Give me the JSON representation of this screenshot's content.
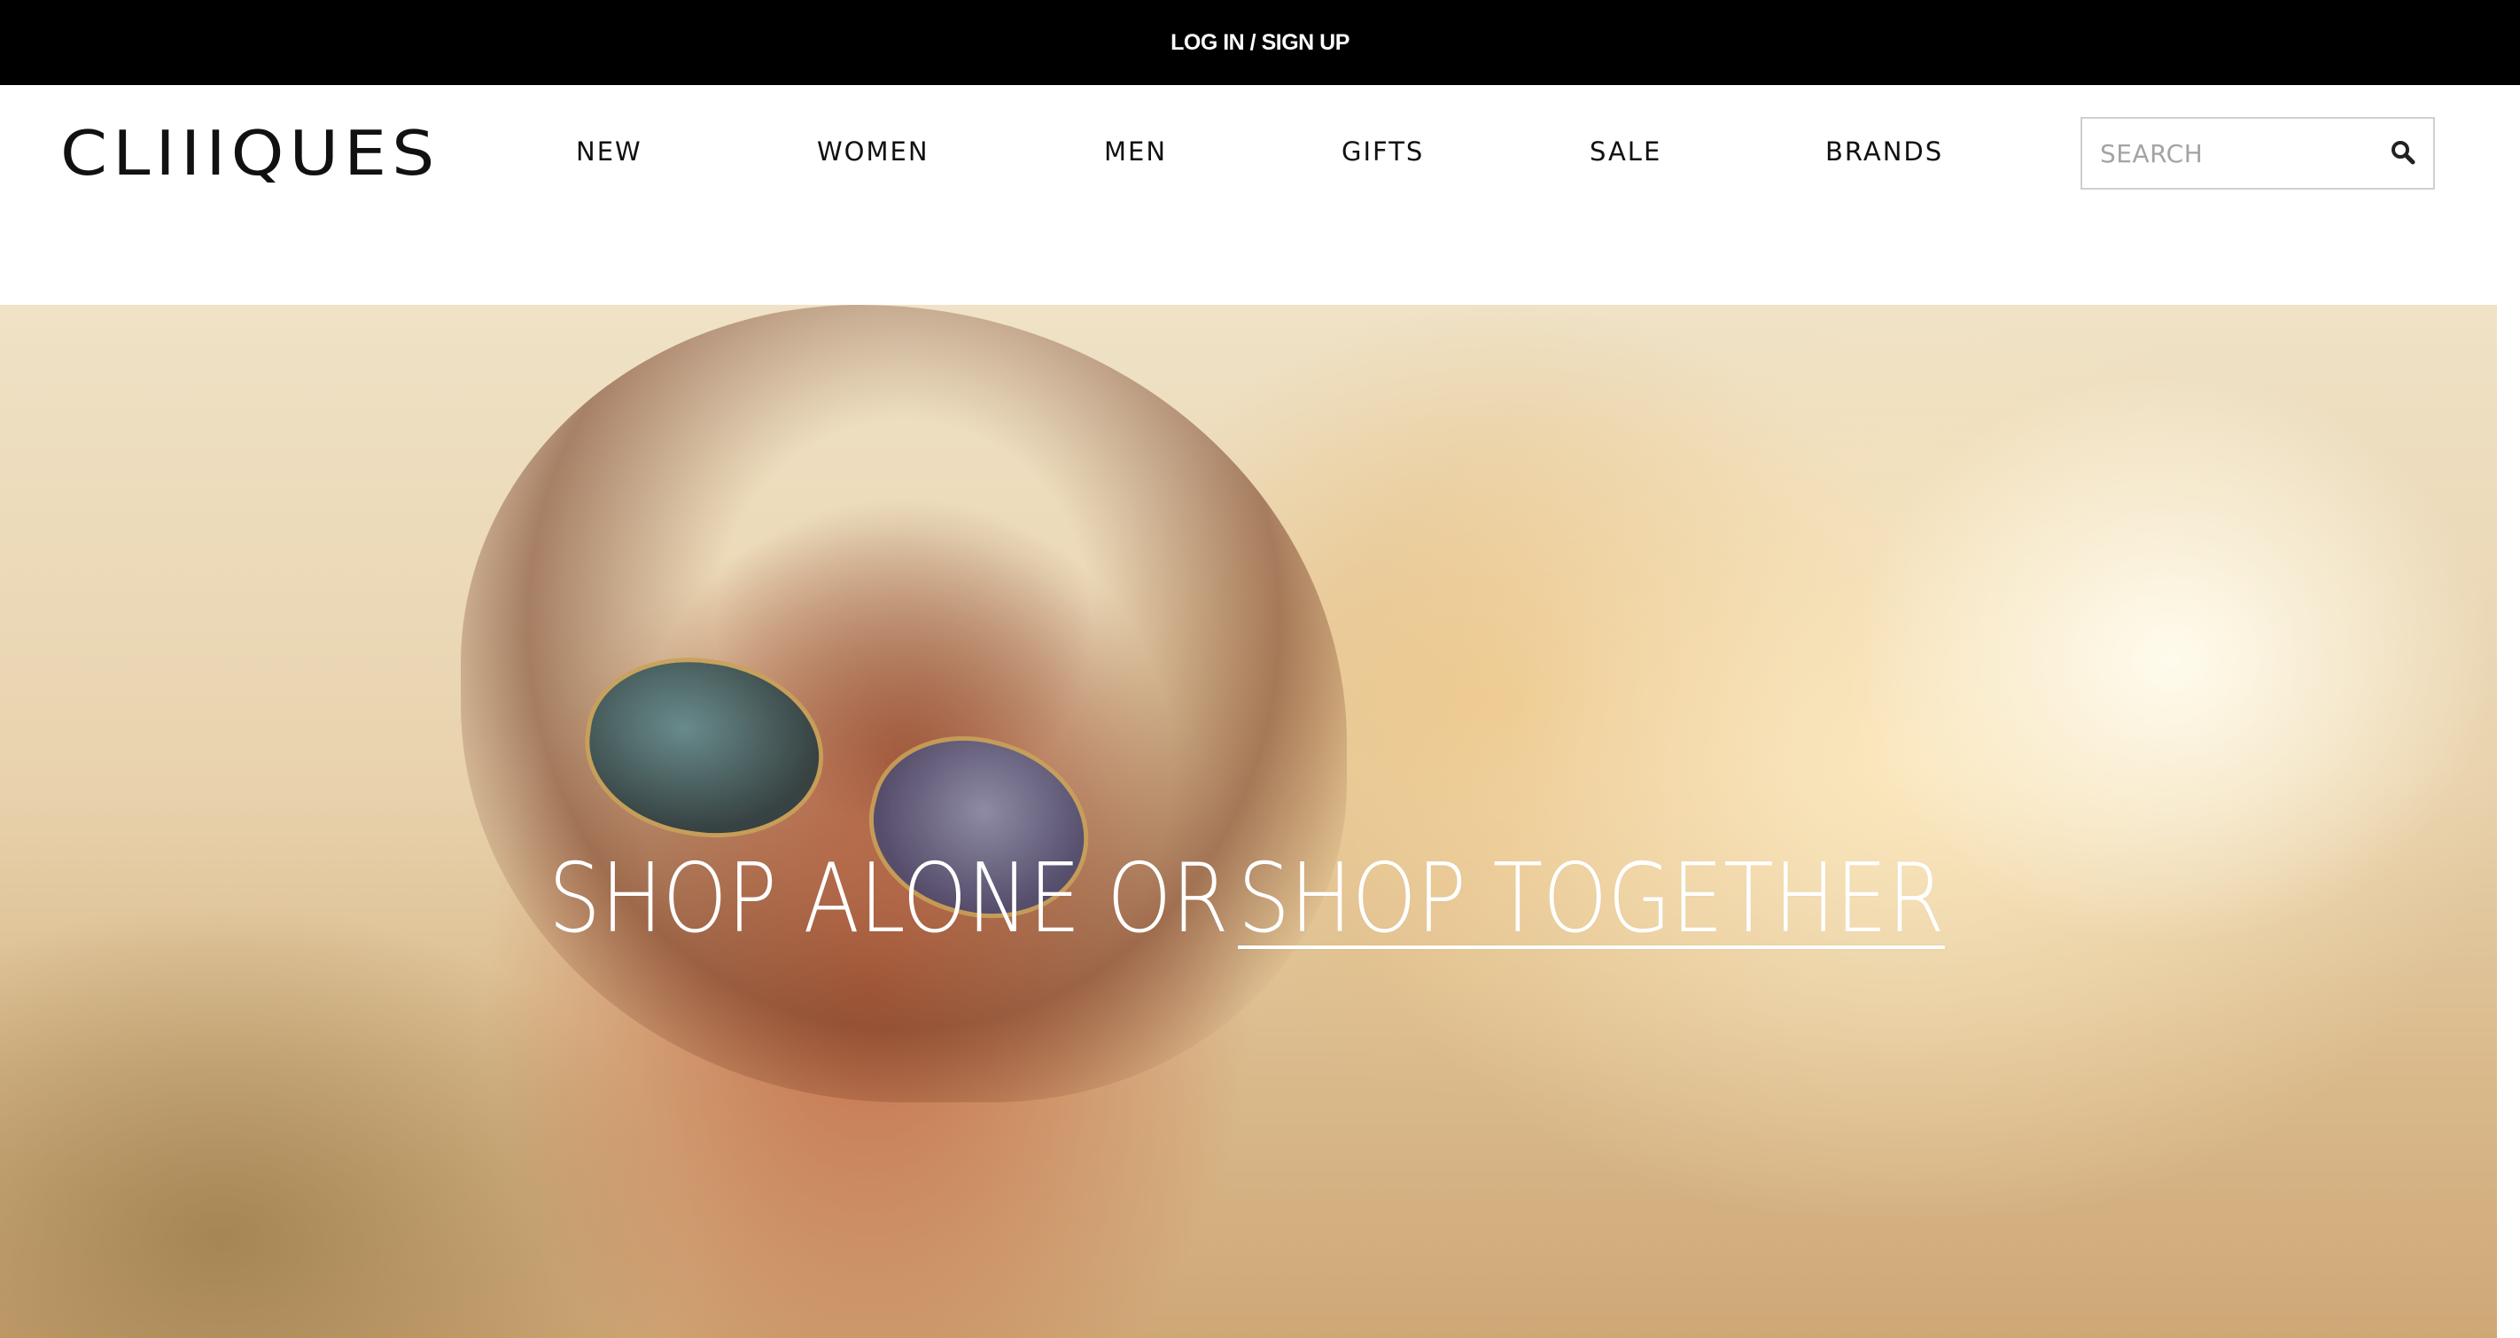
{
  "topbar": {
    "login_label": "LOG IN / SIGN UP"
  },
  "header": {
    "logo_text": "CLIIIQUES",
    "nav": [
      "NEW",
      "WOMEN",
      "MEN",
      "GIFTS",
      "SALE",
      "BRANDS"
    ],
    "search": {
      "placeholder": "SEARCH",
      "icon": "search-icon"
    }
  },
  "hero": {
    "headline_part1": "SHOP ALONE OR",
    "headline_part2": "SHOP TOGETHER"
  },
  "colors": {
    "topbar_bg": "#000000",
    "text": "#111111",
    "hero_text": "#ffffff"
  }
}
